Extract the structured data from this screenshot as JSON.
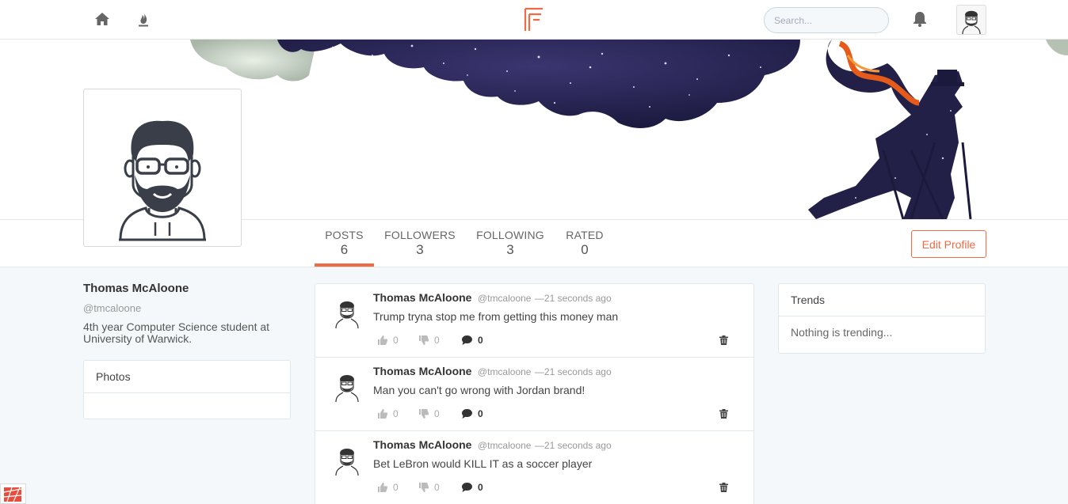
{
  "nav": {
    "home_icon": "home-icon",
    "trending_icon": "flame-icon",
    "logo_icon": "f-logo-icon",
    "search_placeholder": "Search...",
    "bell_icon": "bell-icon",
    "accent": "#f06a45"
  },
  "profile": {
    "stats": [
      {
        "label": "POSTS",
        "value": "6"
      },
      {
        "label": "FOLLOWERS",
        "value": "3"
      },
      {
        "label": "FOLLOWING",
        "value": "3"
      },
      {
        "label": "RATED",
        "value": "0"
      }
    ],
    "edit_label": "Edit Profile",
    "name": "Thomas McAloone",
    "handle": "@tmcaloone",
    "bio": "4th year Computer Science student at University of Warwick."
  },
  "photos": {
    "title": "Photos"
  },
  "trends": {
    "title": "Trends",
    "empty": "Nothing is trending..."
  },
  "posts": [
    {
      "name": "Thomas McAloone",
      "handle": "@tmcaloone",
      "time": "—21 seconds ago",
      "text": "Trump tryna stop me from getting this money man",
      "likes": "0",
      "dislikes": "0",
      "comments": "0"
    },
    {
      "name": "Thomas McAloone",
      "handle": "@tmcaloone",
      "time": "—21 seconds ago",
      "text": "Man you can't go wrong with Jordan brand!",
      "likes": "0",
      "dislikes": "0",
      "comments": "0"
    },
    {
      "name": "Thomas McAloone",
      "handle": "@tmcaloone",
      "time": "—21 seconds ago",
      "text": "Bet LeBron would KILL IT as a soccer player",
      "likes": "0",
      "dislikes": "0",
      "comments": "0"
    }
  ]
}
